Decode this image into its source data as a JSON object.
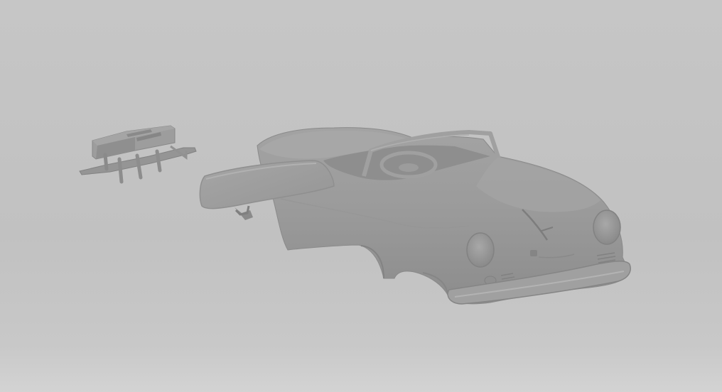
{
  "viewport": {
    "background_color": "#c4c4c4",
    "model_color": "#9a9a9a"
  },
  "scene": {
    "objects": [
      {
        "name": "speedster-body"
      },
      {
        "name": "luggage-rack"
      },
      {
        "name": "hardtop-panel"
      }
    ]
  }
}
